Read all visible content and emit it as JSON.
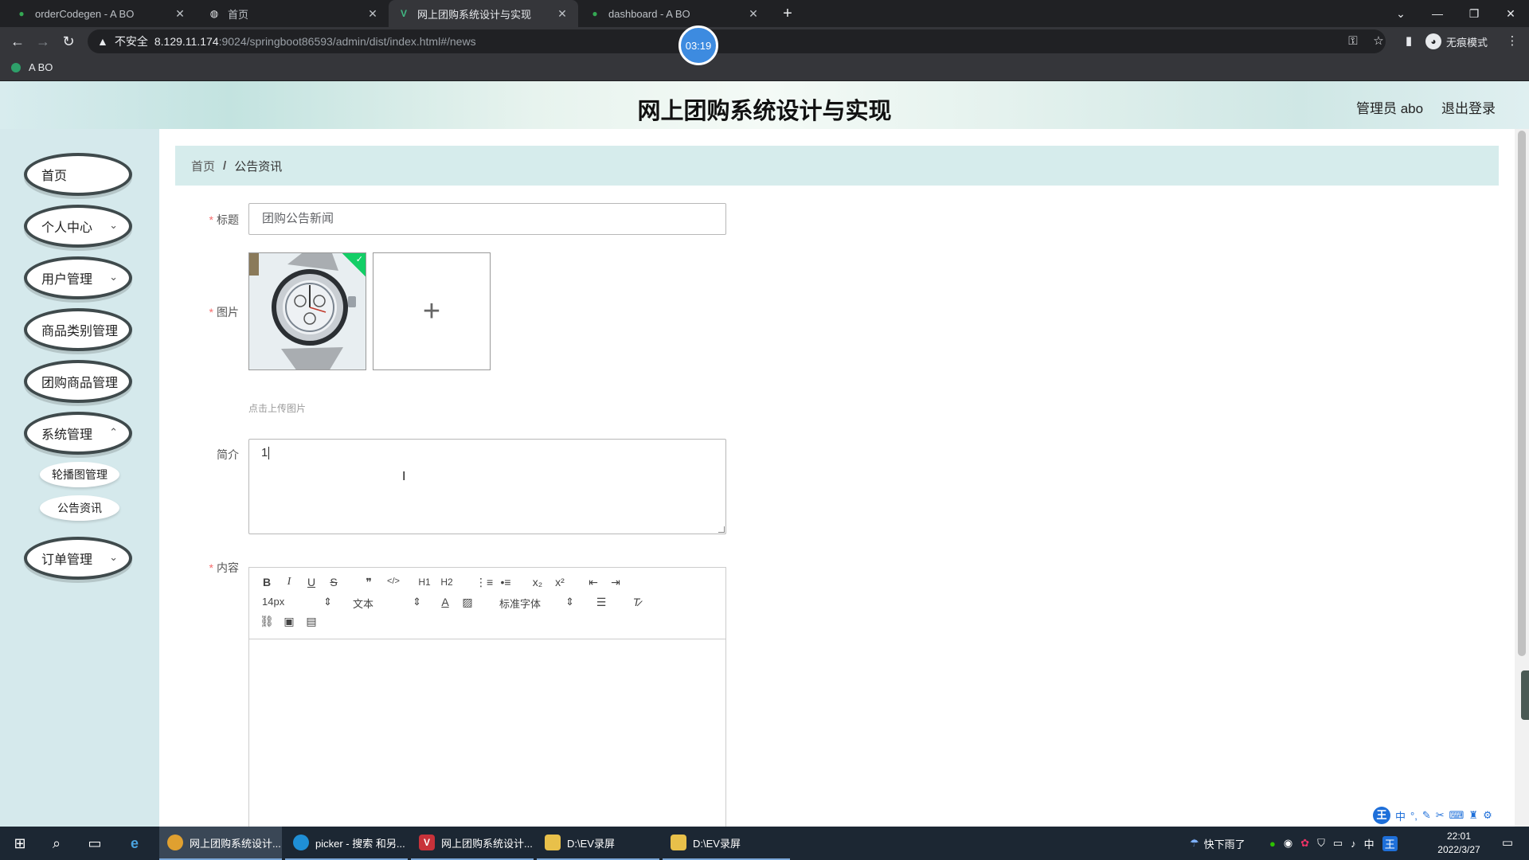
{
  "browser": {
    "tabs": [
      {
        "title": "orderCodegen - A BO",
        "icon": "leaf-icon"
      },
      {
        "title": "首页",
        "icon": "globe-icon"
      },
      {
        "title": "网上团购系统设计与实现",
        "icon": "vue-icon"
      },
      {
        "title": "dashboard - A BO",
        "icon": "leaf-icon"
      }
    ],
    "insecure_label": "不安全",
    "url_host": "8.129.11.174",
    "url_rest": ":9024/springboot86593/admin/dist/index.html#/news",
    "timer": "03:19",
    "profile_label": "无痕模式",
    "bookmark": "A BO"
  },
  "header": {
    "title": "网上团购系统设计与实现",
    "user": "管理员 abo",
    "logout": "退出登录"
  },
  "sidebar": {
    "items": [
      {
        "label": "首页",
        "has_children": false
      },
      {
        "label": "个人中心",
        "has_children": true
      },
      {
        "label": "用户管理",
        "has_children": true
      },
      {
        "label": "商品类别管理",
        "has_children": false
      },
      {
        "label": "团购商品管理",
        "has_children": false
      },
      {
        "label": "系统管理",
        "has_children": true
      },
      {
        "label": "订单管理",
        "has_children": true
      }
    ],
    "submenu": [
      "轮播图管理",
      "公告资讯"
    ]
  },
  "breadcrumb": {
    "home": "首页",
    "separator": "/",
    "current": "公告资讯"
  },
  "form": {
    "title_label": "标题",
    "title_value": "团购公告新闻",
    "image_label": "图片",
    "upload_tip": "点击上传图片",
    "intro_label": "简介",
    "intro_value": "1",
    "content_label": "内容"
  },
  "editor": {
    "font_size": "14px",
    "format": "文本",
    "font_family": "标准字体",
    "buttons": [
      "B",
      "I",
      "U",
      "S",
      "❞",
      "</>",
      "H1",
      "H2",
      "ordered-list",
      "bullet-list",
      "x₂",
      "x²",
      "outdent",
      "indent",
      "A",
      "highlight",
      "align",
      "clear-format",
      "link",
      "image",
      "video"
    ]
  },
  "taskbar": {
    "items": [
      "网上团购系统设计...",
      "picker - 搜索 和另...",
      "网上团购系统设计...",
      "D:\\EV录屏",
      "D:\\EV录屏"
    ],
    "weather": "快下雨了",
    "ime": "中",
    "time": "22:01",
    "date": "2022/3/27"
  },
  "colors": {
    "accent": "#3d8be0",
    "sidebar_bg": "#d5e9ec",
    "breadcrumb_bg": "#d6ecec",
    "required": "#f56c6c",
    "success": "#13ce66"
  }
}
